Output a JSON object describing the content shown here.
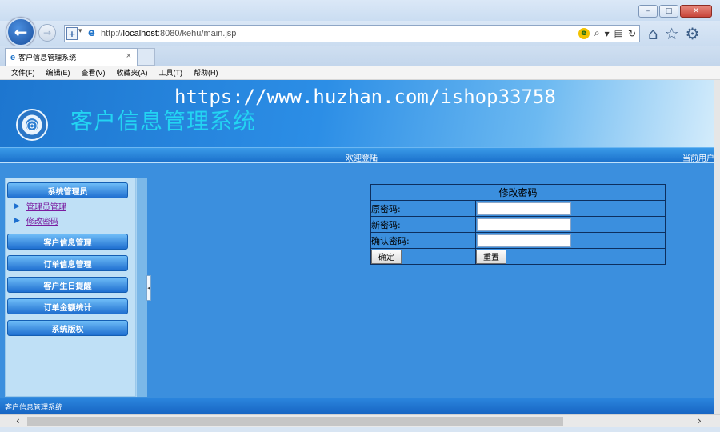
{
  "browser": {
    "window_buttons": [
      "–",
      "□",
      "✕"
    ],
    "url_host": "http://",
    "url_host_bold": "localhost",
    "url_path": ":8080/kehu/main.jsp",
    "search_symbol": "⌕",
    "tab_title": "客户信息管理系统",
    "tab_close": "×",
    "menu": [
      "文件(F)",
      "编辑(E)",
      "查看(V)",
      "收藏夹(A)",
      "工具(T)",
      "帮助(H)"
    ]
  },
  "header": {
    "title": "客户信息管理系统",
    "watermark": "https://www.huzhan.com/ishop33758",
    "welcome": "欢迎登陆",
    "current_user": "当前用户"
  },
  "sidebar": {
    "group_title": "系统管理员",
    "sub_items": [
      "管理员管理",
      "修改密码"
    ],
    "groups": [
      "客户信息管理",
      "订单信息管理",
      "客户生日提醒",
      "订单金额统计",
      "系统版权"
    ]
  },
  "form": {
    "caption": "修改密码",
    "labels": [
      "原密码:",
      "新密码:",
      "确认密码:"
    ],
    "submit": "确定",
    "reset": "重置"
  },
  "footer": {
    "text": "客户信息管理系统"
  }
}
